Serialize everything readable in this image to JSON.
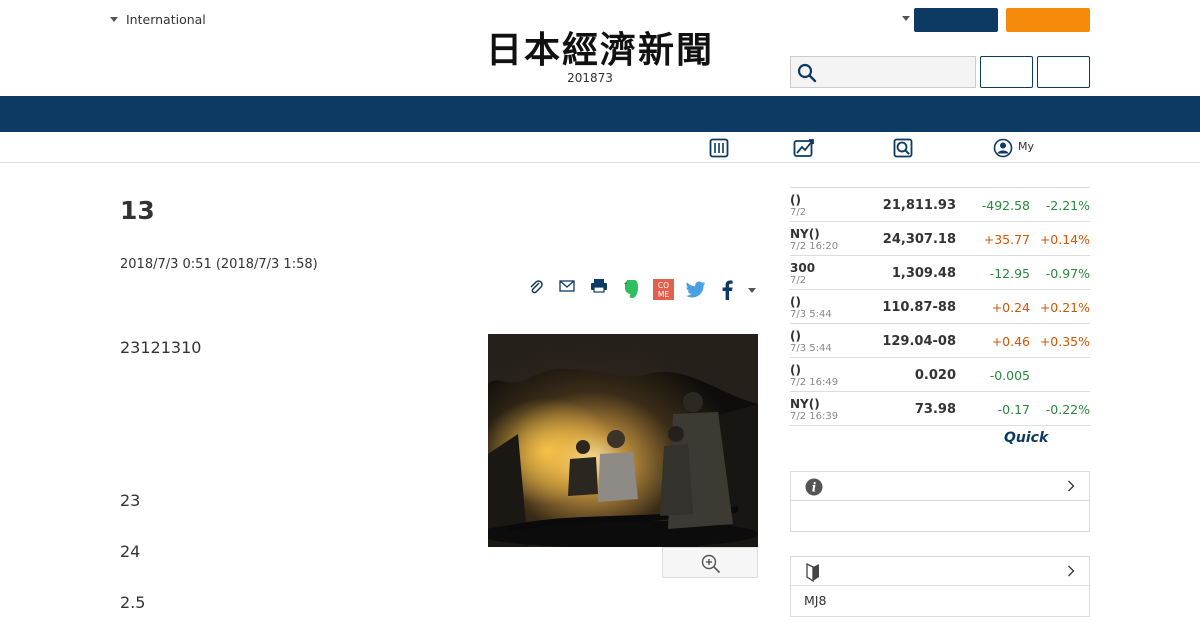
{
  "header": {
    "edition_label": "International",
    "logo_text": "日本經濟新聞",
    "edition_number": "201873"
  },
  "subnav": {
    "my_label": "My"
  },
  "article": {
    "headline": "13",
    "timestamp": "2018/7/3 0:51 (2018/7/3 1:58)",
    "paragraphs": [
      "23121310",
      "23",
      "24",
      "2.5"
    ]
  },
  "market": {
    "rows": [
      {
        "name": "()",
        "date": "7/2",
        "value": "21,811.93",
        "change": "-492.58",
        "pct": "-2.21%",
        "dir": "down"
      },
      {
        "name": "NY()",
        "date": "7/2 16:20",
        "value": "24,307.18",
        "change": "+35.77",
        "pct": "+0.14%",
        "dir": "up"
      },
      {
        "name": "300",
        "date": "7/2",
        "value": "1,309.48",
        "change": "-12.95",
        "pct": "-0.97%",
        "dir": "down"
      },
      {
        "name": "()",
        "date": "7/3 5:44",
        "value": "110.87-88",
        "change": "+0.24",
        "pct": "+0.21%",
        "dir": "up"
      },
      {
        "name": "()",
        "date": "7/3 5:44",
        "value": "129.04-08",
        "change": "+0.46",
        "pct": "+0.35%",
        "dir": "up"
      },
      {
        "name": "()",
        "date": "7/2 16:49",
        "value": "0.020",
        "change": "-0.005",
        "pct": "",
        "dir": "down"
      },
      {
        "name": "NY()",
        "date": "7/2 16:39",
        "value": "73.98",
        "change": "-0.17",
        "pct": "-0.22%",
        "dir": "down"
      }
    ],
    "source_logo": "Quick",
    "colors": {
      "up": "#d35400",
      "down": "#27893a"
    }
  },
  "info_box": {
    "icon": "info-icon",
    "body": ""
  },
  "beginner_box": {
    "icon": "beginner-mark-icon",
    "body": "MJ8"
  },
  "colors": {
    "navy": "#0d3a63",
    "orange": "#f5890a"
  }
}
